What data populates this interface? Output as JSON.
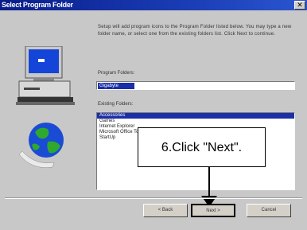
{
  "window": {
    "title": "Select Program Folder"
  },
  "instructions": "Setup will add program icons to the Program Folder listed below. You may type a new folder name, or select one from the existing folders list. Click Next to continue.",
  "program_folder": {
    "label": "Program Folders:",
    "value": "Gigabyte"
  },
  "existing_folders": {
    "label": "Existing Folders:",
    "items": [
      "Accessories",
      "Games",
      "Internet Explorer",
      "Microsoft Office Tools",
      "StartUp"
    ],
    "selected_index": 0
  },
  "callout": {
    "text": "6.Click \"Next\"."
  },
  "buttons": {
    "back": "< Back",
    "next": "Next >",
    "cancel": "Cancel"
  }
}
